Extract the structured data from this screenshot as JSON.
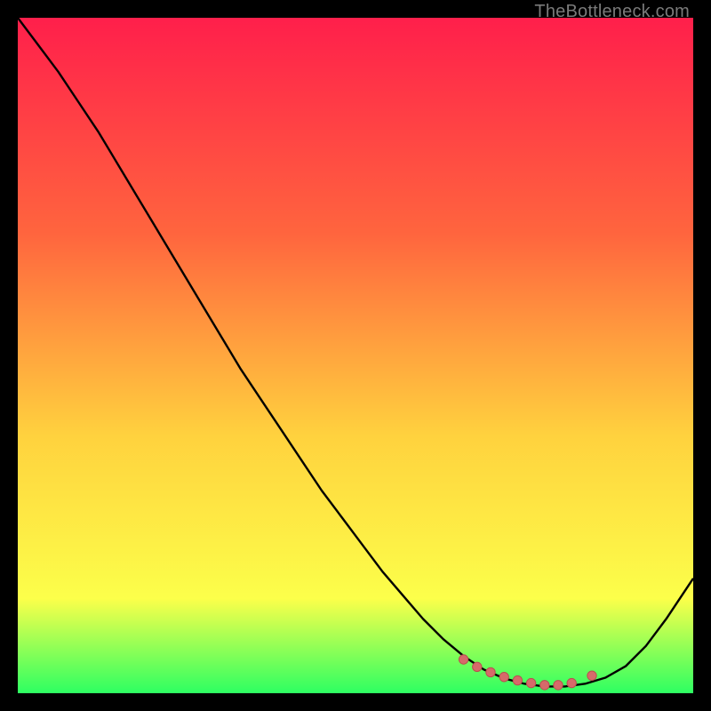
{
  "watermark": "TheBottleneck.com",
  "colors": {
    "gradient_top": "#ff1f4b",
    "gradient_mid1": "#ff653e",
    "gradient_mid2": "#ffd23e",
    "gradient_mid3": "#fcff4a",
    "gradient_bottom": "#2dff62",
    "curve": "#000000",
    "marker_fill": "#d66a6a",
    "marker_stroke": "#b94f4f"
  },
  "chart_data": {
    "type": "line",
    "title": "",
    "xlabel": "",
    "ylabel": "",
    "xlim": [
      0,
      100
    ],
    "ylim": [
      0,
      100
    ],
    "series": [
      {
        "name": "bottleneck-curve",
        "x": [
          0,
          3,
          6,
          9,
          12,
          15,
          18,
          21,
          24,
          27,
          30,
          33,
          36,
          39,
          42,
          45,
          48,
          51,
          54,
          57,
          60,
          63,
          66,
          69,
          72,
          75,
          78,
          81,
          84,
          87,
          90,
          93,
          96,
          100
        ],
        "y": [
          100,
          96,
          92,
          87.5,
          83,
          78,
          73,
          68,
          63,
          58,
          53,
          48,
          43.5,
          39,
          34.5,
          30,
          26,
          22,
          18,
          14.5,
          11,
          8,
          5.5,
          3.5,
          2.2,
          1.4,
          1.0,
          1.0,
          1.4,
          2.3,
          4.0,
          7.0,
          11,
          17
        ]
      }
    ],
    "markers": {
      "name": "optimal-range",
      "x": [
        66,
        68,
        70,
        72,
        74,
        76,
        78,
        80,
        82,
        85
      ],
      "y": [
        5.0,
        3.9,
        3.1,
        2.4,
        1.9,
        1.5,
        1.2,
        1.2,
        1.5,
        2.6
      ]
    }
  }
}
